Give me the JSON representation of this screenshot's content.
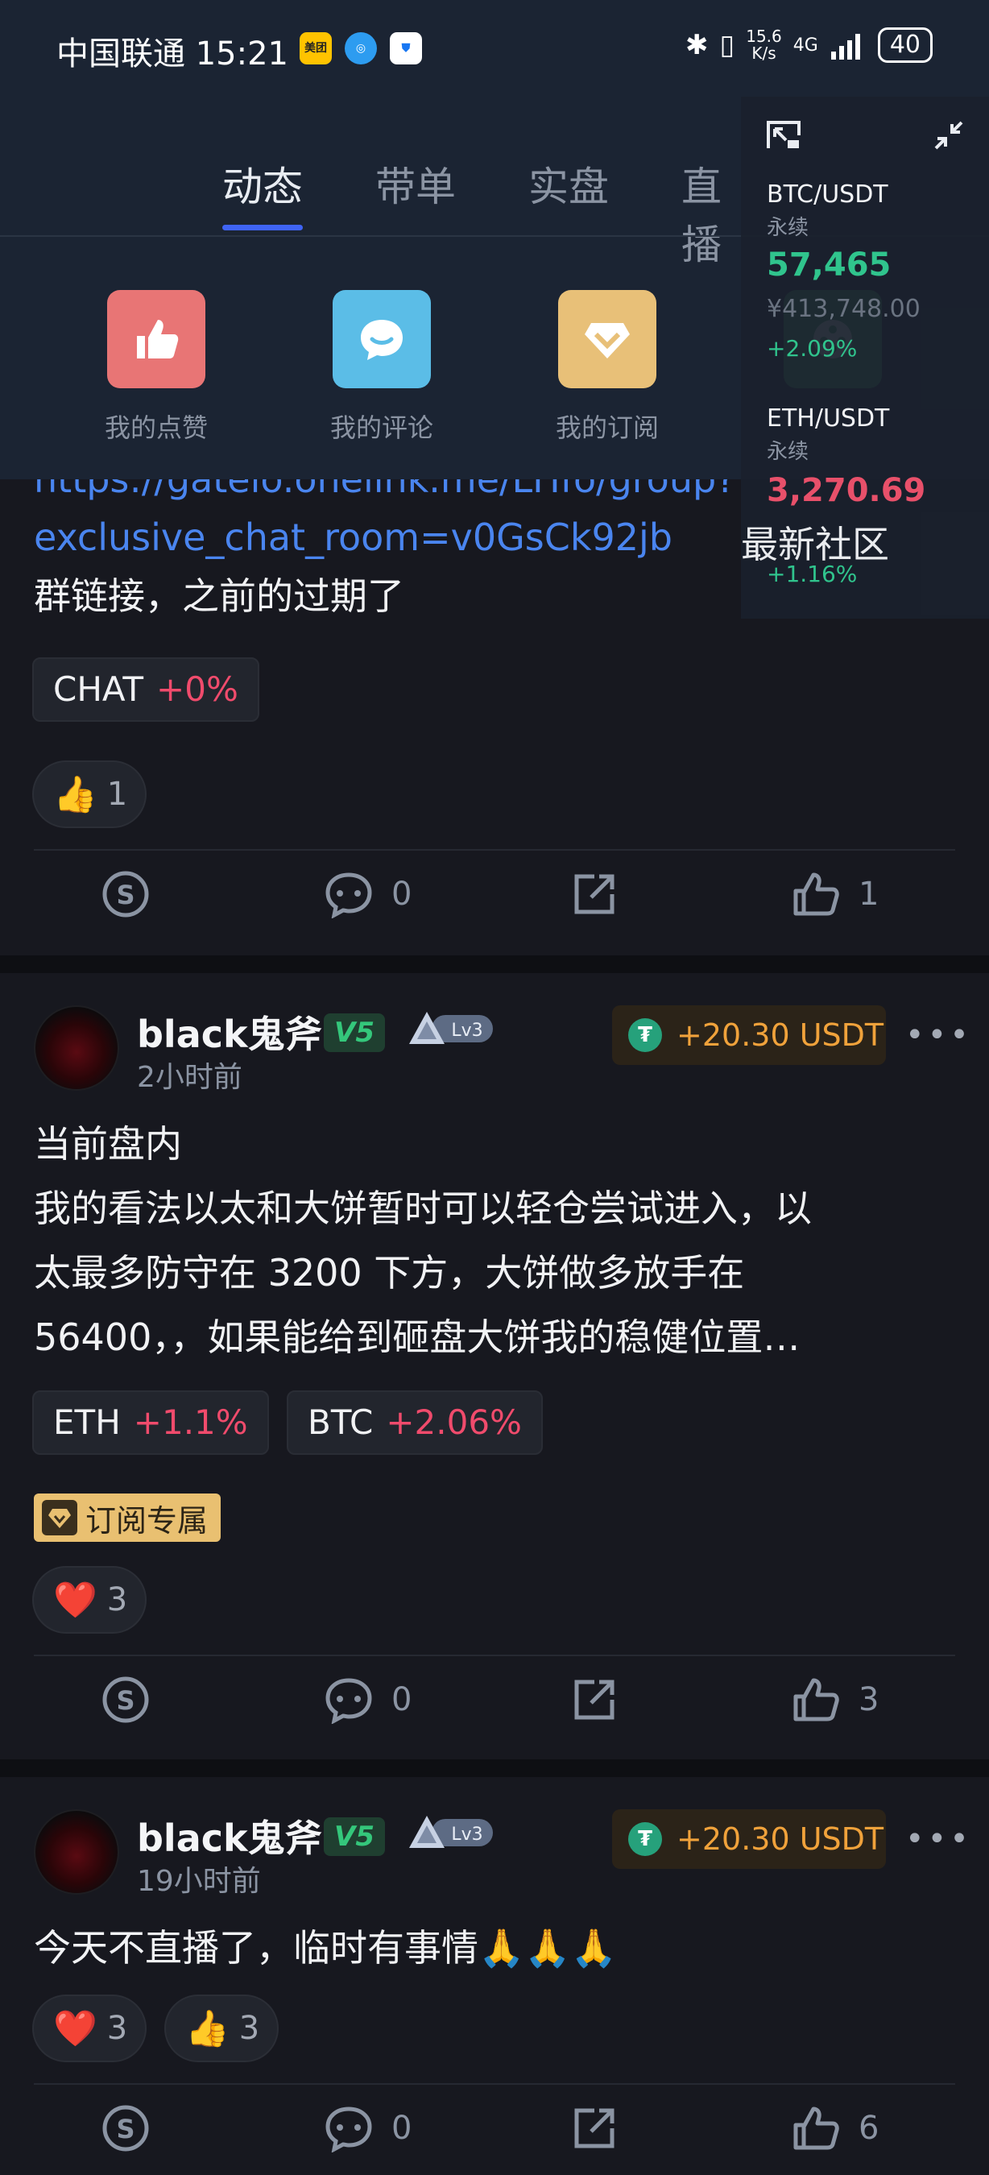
{
  "status_bar": {
    "carrier_time": "中国联通 15:21",
    "app_icons": [
      "meituan-icon",
      "compass-icon",
      "shield-icon"
    ],
    "meituan_label": "美团",
    "net_speed_value": "15.6",
    "net_speed_unit": "K/s",
    "signal": "4G",
    "battery": "40"
  },
  "tabs": [
    {
      "label": "动态",
      "active": true
    },
    {
      "label": "带单",
      "active": false
    },
    {
      "label": "实盘",
      "active": false
    },
    {
      "label": "直播",
      "active": false
    }
  ],
  "shortcuts": [
    {
      "label": "我的点赞",
      "icon": "thumbs-up-icon"
    },
    {
      "label": "我的评论",
      "icon": "chat-bubble-icon"
    },
    {
      "label": "我的订阅",
      "icon": "diamond-icon"
    }
  ],
  "ticker": {
    "items": [
      {
        "pair": "BTC/USDT",
        "type": "永续",
        "price": "57,465",
        "cny": "¥413,748.00",
        "change": "+2.09%",
        "direction": "up"
      },
      {
        "pair": "ETH/USDT",
        "type": "永续",
        "price": "3,270.69",
        "change": "+1.16%",
        "direction": "down"
      }
    ]
  },
  "post1": {
    "link_line1": "https://gateio.onelink.me/LHfo/group?",
    "link_line2": "exclusive_chat_room=v0GsCk92jb",
    "community": "最新社区",
    "text": "群链接，之前的过期了",
    "tags": [
      {
        "symbol": "CHAT",
        "change": "+0%"
      }
    ],
    "reactions": [
      {
        "emoji": "👍",
        "count": "1"
      }
    ],
    "comment_count": "0",
    "like_count": "1"
  },
  "post2": {
    "username": "black鬼斧",
    "vip": "V5",
    "level": "Lv3",
    "time": "2小时前",
    "reward": "+20.30 USDT",
    "more": "•••",
    "text_lines": [
      "当前盘内",
      "我的看法以太和大饼暂时可以轻仓尝试进入，以",
      "太最多防守在 3200 下方，大饼做多放手在",
      "56400，，如果能给到砸盘大饼我的稳健位置…"
    ],
    "tags": [
      {
        "symbol": "ETH",
        "change": "+1.1%"
      },
      {
        "symbol": "BTC",
        "change": "+2.06%"
      }
    ],
    "sub_badge": "订阅专属",
    "reactions": [
      {
        "emoji": "❤️",
        "count": "3"
      }
    ],
    "comment_count": "0",
    "like_count": "3"
  },
  "post3": {
    "username": "black鬼斧",
    "vip": "V5",
    "level": "Lv3",
    "time": "19小时前",
    "reward": "+20.30 USDT",
    "more": "•••",
    "text": "今天不直播了，临时有事情🙏🙏🙏",
    "reactions": [
      {
        "emoji": "❤️",
        "count": "3"
      },
      {
        "emoji": "👍",
        "count": "3"
      }
    ],
    "comment_count": "0",
    "like_count": "6"
  },
  "colors": {
    "accent": "#3f64f6",
    "up": "#30c48d",
    "down": "#e8506a",
    "reward": "#f0a23b",
    "link": "#4a85ef",
    "background": "#17181f"
  }
}
